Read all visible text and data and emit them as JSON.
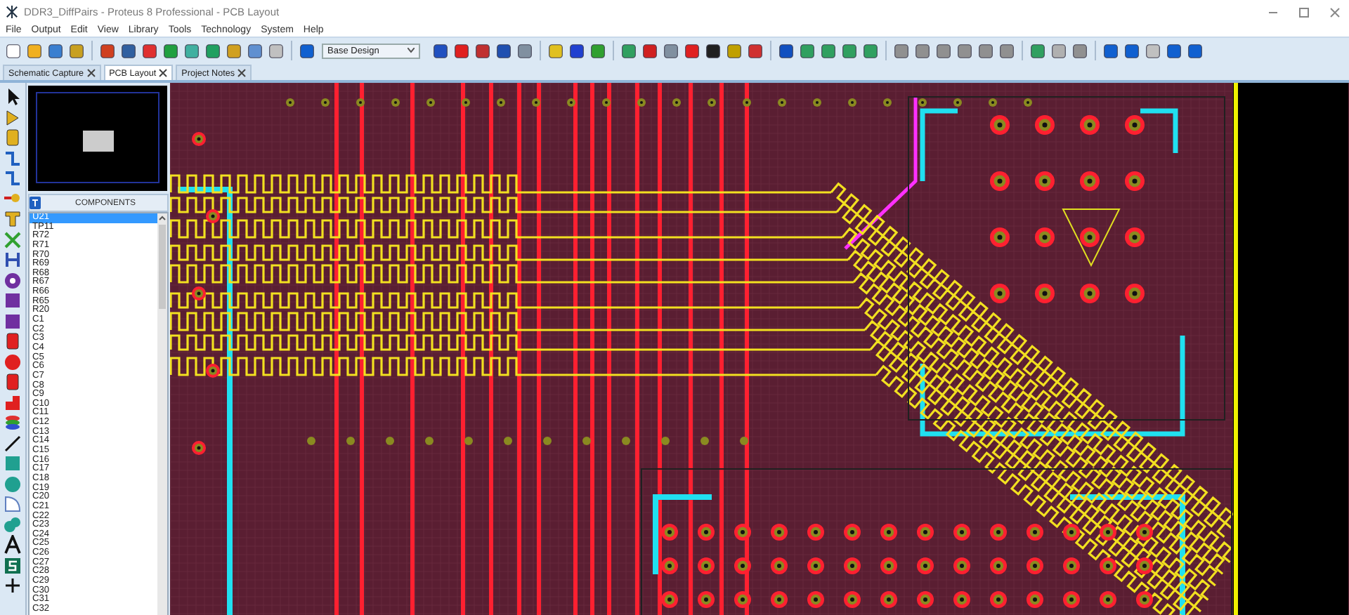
{
  "window": {
    "title": "DDR3_DiffPairs - Proteus 8 Professional - PCB Layout"
  },
  "menu": [
    "File",
    "Output",
    "Edit",
    "View",
    "Library",
    "Tools",
    "Technology",
    "System",
    "Help"
  ],
  "toolbar": {
    "layer_dropdown": {
      "value": "Base Design"
    }
  },
  "tabs": [
    {
      "label": "Schematic Capture",
      "selected": false
    },
    {
      "label": "PCB Layout",
      "selected": true
    },
    {
      "label": "Project Notes",
      "selected": false
    }
  ],
  "components_panel": {
    "title": "COMPONENTS",
    "items": [
      {
        "label": "U21",
        "selected": true
      },
      {
        "label": "TP11",
        "selected": false
      },
      {
        "label": "R72",
        "selected": false
      },
      {
        "label": "R71",
        "selected": false
      },
      {
        "label": "R70",
        "selected": false
      },
      {
        "label": "R69",
        "selected": false
      },
      {
        "label": "R68",
        "selected": false
      },
      {
        "label": "R67",
        "selected": false
      },
      {
        "label": "R66",
        "selected": false
      },
      {
        "label": "R65",
        "selected": false
      },
      {
        "label": "R20",
        "selected": false
      },
      {
        "label": "C1",
        "selected": false
      },
      {
        "label": "C2",
        "selected": false
      },
      {
        "label": "C3",
        "selected": false
      },
      {
        "label": "C4",
        "selected": false
      },
      {
        "label": "C5",
        "selected": false
      },
      {
        "label": "C6",
        "selected": false
      },
      {
        "label": "C7",
        "selected": false
      },
      {
        "label": "C8",
        "selected": false
      },
      {
        "label": "C9",
        "selected": false
      },
      {
        "label": "C10",
        "selected": false
      },
      {
        "label": "C11",
        "selected": false
      },
      {
        "label": "C12",
        "selected": false
      },
      {
        "label": "C13",
        "selected": false
      },
      {
        "label": "C14",
        "selected": false
      },
      {
        "label": "C15",
        "selected": false
      },
      {
        "label": "C16",
        "selected": false
      },
      {
        "label": "C17",
        "selected": false
      },
      {
        "label": "C18",
        "selected": false
      },
      {
        "label": "C19",
        "selected": false
      },
      {
        "label": "C20",
        "selected": false
      },
      {
        "label": "C21",
        "selected": false
      },
      {
        "label": "C22",
        "selected": false
      },
      {
        "label": "C23",
        "selected": false
      },
      {
        "label": "C24",
        "selected": false
      },
      {
        "label": "C25",
        "selected": false
      },
      {
        "label": "C26",
        "selected": false
      },
      {
        "label": "C27",
        "selected": false
      },
      {
        "label": "C28",
        "selected": false
      },
      {
        "label": "C29",
        "selected": false
      },
      {
        "label": "C30",
        "selected": false
      },
      {
        "label": "C31",
        "selected": false
      },
      {
        "label": "C32",
        "selected": false
      }
    ]
  }
}
